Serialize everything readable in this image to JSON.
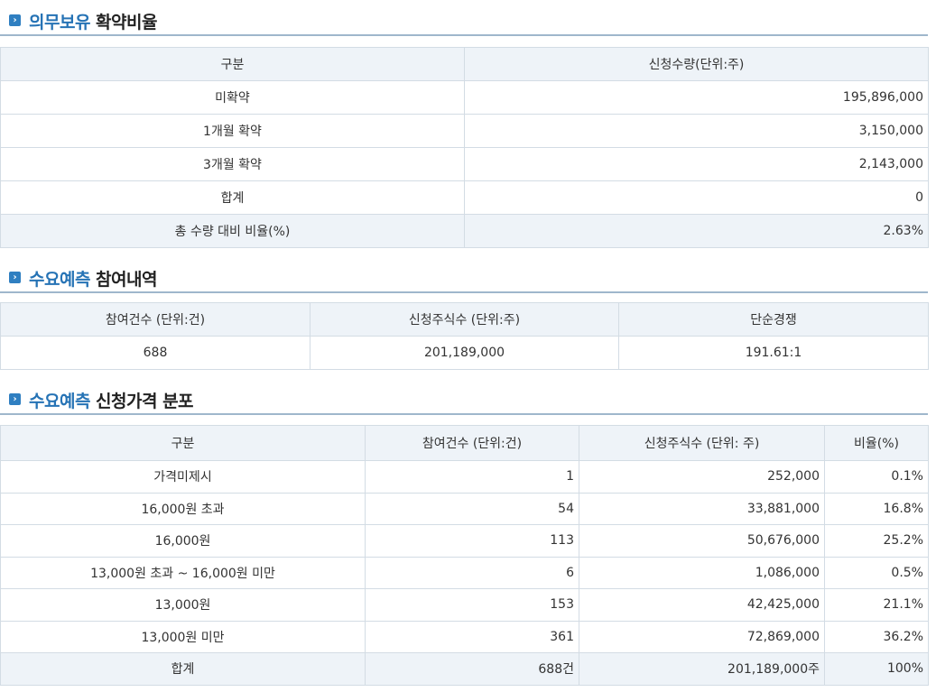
{
  "lockup": {
    "title_accent": "의무보유",
    "title_rest": "확약비율",
    "headers": [
      "구분",
      "신청수량(단위:주)"
    ],
    "rows": [
      {
        "label": "미확약",
        "value": "195,896,000"
      },
      {
        "label": "1개월 확약",
        "value": "3,150,000"
      },
      {
        "label": "3개월 확약",
        "value": "2,143,000"
      },
      {
        "label": "합계",
        "value": "0"
      },
      {
        "label": "총 수량 대비 비율(%)",
        "value": "2.63%"
      }
    ]
  },
  "participation": {
    "title_accent": "수요예측",
    "title_rest": "참여내역",
    "headers": [
      "참여건수 (단위:건)",
      "신청주식수 (단위:주)",
      "단순경쟁"
    ],
    "row": [
      "688",
      "201,189,000",
      "191.61:1"
    ]
  },
  "distribution": {
    "title_accent": "수요예측",
    "title_rest": "신청가격 분포",
    "headers": [
      "구분",
      "참여건수 (단위:건)",
      "신청주식수 (단위: 주)",
      "비율(%)"
    ],
    "rows": [
      [
        "가격미제시",
        "1",
        "252,000",
        "0.1%"
      ],
      [
        "16,000원 초과",
        "54",
        "33,881,000",
        "16.8%"
      ],
      [
        "16,000원",
        "113",
        "50,676,000",
        "25.2%"
      ],
      [
        "13,000원 초과 ~ 16,000원 미만",
        "6",
        "1,086,000",
        "0.5%"
      ],
      [
        "13,000원",
        "153",
        "42,425,000",
        "21.1%"
      ],
      [
        "13,000원 미만",
        "361",
        "72,869,000",
        "36.2%"
      ]
    ],
    "total": [
      "합계",
      "688건",
      "201,189,000주",
      "100%"
    ]
  },
  "icons": {
    "section": "arrow-right-icon"
  },
  "colors": {
    "accent": "#2673b5",
    "header_bg": "#eef3f8",
    "border": "#d3dce4",
    "rule": "#9fb7cc"
  }
}
